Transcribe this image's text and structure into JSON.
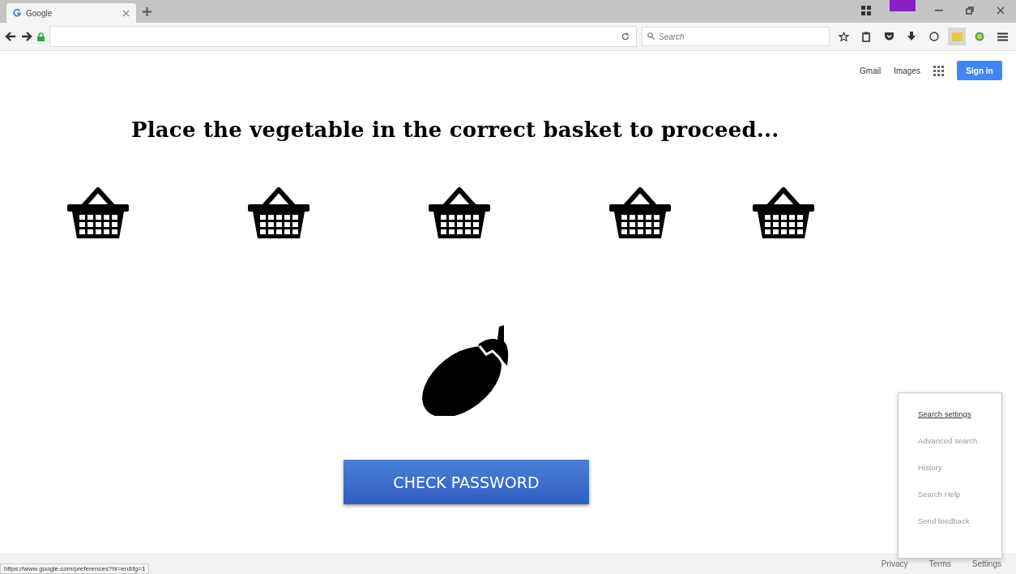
{
  "browser": {
    "tab": {
      "title": "Google"
    },
    "search": {
      "placeholder": "Search"
    }
  },
  "header": {
    "links": [
      "Gmail",
      "Images"
    ],
    "sign_in": "Sign in"
  },
  "title": "Place the vegetable in the correct basket to proceed...",
  "baskets": [
    {
      "kind": "basket"
    },
    {
      "kind": "basket"
    },
    {
      "kind": "basket"
    },
    {
      "kind": "basket"
    },
    {
      "kind": "basket"
    }
  ],
  "vegetable": {
    "kind": "eggplant"
  },
  "button": "CHECK PASSWORD",
  "settings_menu": [
    {
      "label": "Search settings",
      "selected": true
    },
    {
      "label": "Advanced search",
      "selected": false
    },
    {
      "label": "History",
      "selected": false
    },
    {
      "label": "Search Help",
      "selected": false
    },
    {
      "label": "Send feedback",
      "selected": false
    }
  ],
  "footer": {
    "right": [
      "Privacy",
      "Terms",
      "Settings"
    ]
  },
  "status_url": "https://www.google.com/preferences?hl=en&fg=1"
}
